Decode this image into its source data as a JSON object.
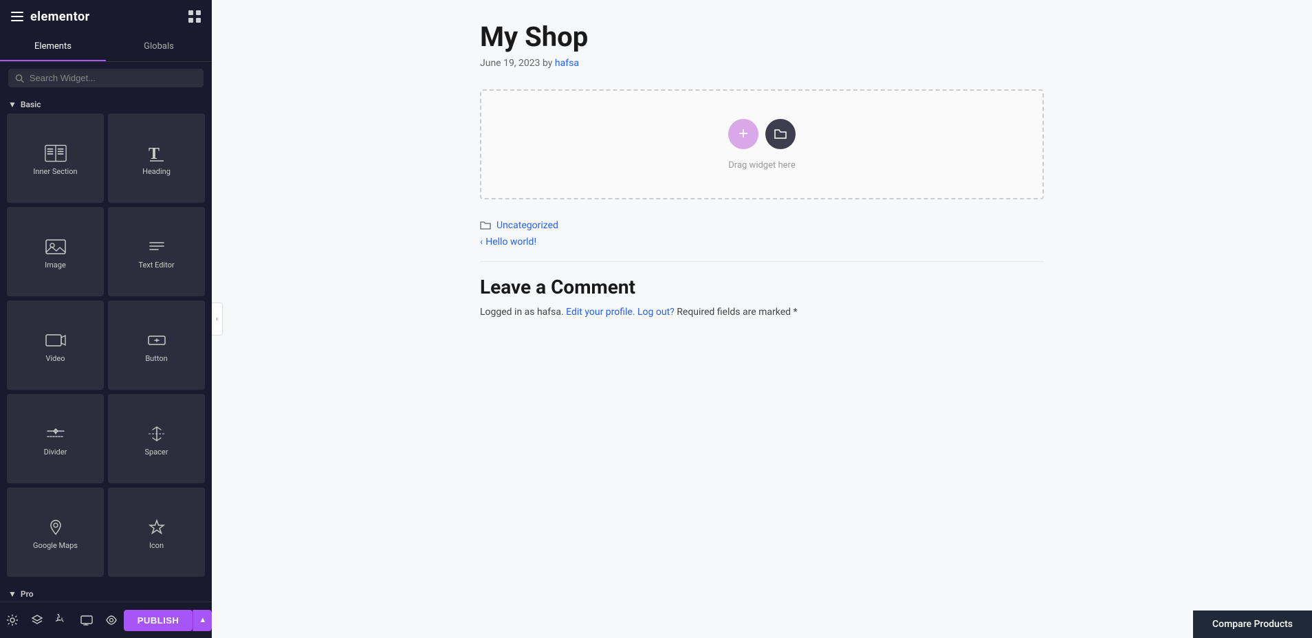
{
  "sidebar": {
    "logo": "elementor",
    "tabs": [
      {
        "id": "elements",
        "label": "Elements",
        "active": true
      },
      {
        "id": "globals",
        "label": "Globals",
        "active": false
      }
    ],
    "search": {
      "placeholder": "Search Widget..."
    },
    "sections": [
      {
        "id": "basic",
        "label": "Basic",
        "widgets": [
          {
            "id": "inner-section",
            "label": "Inner Section",
            "icon": "inner-section-icon"
          },
          {
            "id": "heading",
            "label": "Heading",
            "icon": "heading-icon"
          },
          {
            "id": "image",
            "label": "Image",
            "icon": "image-icon"
          },
          {
            "id": "text-editor",
            "label": "Text Editor",
            "icon": "text-editor-icon"
          },
          {
            "id": "video",
            "label": "Video",
            "icon": "video-icon"
          },
          {
            "id": "button",
            "label": "Button",
            "icon": "button-icon"
          },
          {
            "id": "divider",
            "label": "Divider",
            "icon": "divider-icon"
          },
          {
            "id": "spacer",
            "label": "Spacer",
            "icon": "spacer-icon"
          },
          {
            "id": "google-maps",
            "label": "Google Maps",
            "icon": "google-maps-icon"
          },
          {
            "id": "icon",
            "label": "Icon",
            "icon": "icon-icon"
          }
        ]
      },
      {
        "id": "pro",
        "label": "Pro",
        "widgets": []
      }
    ],
    "footer": {
      "publish_label": "PUBLISH"
    }
  },
  "main": {
    "post_title": "My Shop",
    "post_meta": {
      "date": "June 19, 2023",
      "by": "by",
      "author": "hafsa"
    },
    "drop_zone_text": "Drag widget here",
    "categories_label": "",
    "categories_link": "Uncategorized",
    "nav_prev_label": "Hello world!",
    "comments_title": "Leave a Comment",
    "logged_in_text": "Logged in as hafsa.",
    "edit_profile_link": "Edit your profile.",
    "logout_link": "Log out?",
    "required_text": "Required fields are marked",
    "required_marker": "*"
  },
  "compare_bar": {
    "label": "Compare Products"
  }
}
